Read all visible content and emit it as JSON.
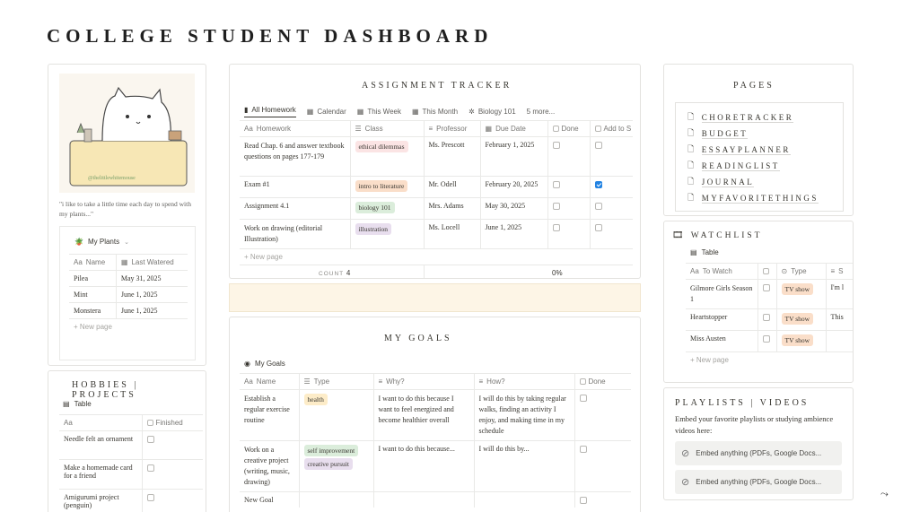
{
  "page_title": "COLLEGE STUDENT DASHBOARD",
  "quote": "\"i like to take a little time each day to spend with my plants...\"",
  "image_watermark": "@thelittlewhitemouse",
  "plants": {
    "db_title": "My Plants",
    "columns": [
      "Name",
      "Last Watered"
    ],
    "rows": [
      {
        "name": "Pilea",
        "date": "May 31, 2025"
      },
      {
        "name": "Mint",
        "date": "June 1, 2025"
      },
      {
        "name": "Monstera",
        "date": "June 1, 2025"
      }
    ],
    "new_page": "New page"
  },
  "hobbies": {
    "title": "HOBBIES | PROJECTS",
    "view": "Table",
    "columns": [
      "",
      "Finished"
    ],
    "rows": [
      {
        "name": "Needle felt an ornament"
      },
      {
        "name": "Make a homemade card for a friend"
      },
      {
        "name": "Amigurumi project (penguin)"
      }
    ]
  },
  "assignments": {
    "title": "ASSIGNMENT TRACKER",
    "tabs": [
      "All Homework",
      "Calendar",
      "This Week",
      "This Month",
      "Biology 101",
      "5 more..."
    ],
    "columns": [
      "Homework",
      "Class",
      "Professor",
      "Due Date",
      "Done",
      "Add to S"
    ],
    "rows": [
      {
        "hw": "Read Chap. 6 and answer textbook questions on pages 177-179",
        "cls": "ethical dilemmas",
        "prof": "Ms. Prescott",
        "due": "February 1, 2025",
        "done": false,
        "add": false
      },
      {
        "hw": "Exam #1",
        "cls": "intro to literature",
        "prof": "Mr. Odell",
        "due": "February 20, 2025",
        "done": false,
        "add": true
      },
      {
        "hw": "Assignment 4.1",
        "cls": "biology 101",
        "prof": "Mrs. Adams",
        "due": "May 30, 2025",
        "done": false,
        "add": false
      },
      {
        "hw": "Work on drawing (editorial Illustration)",
        "cls": "illustration",
        "prof": "Ms. Locell",
        "due": "June 1, 2025",
        "done": false,
        "add": false
      }
    ],
    "new_page": "New page",
    "count_label": "COUNT",
    "count": "4",
    "percent": "0%"
  },
  "goals": {
    "title": "MY GOALS",
    "db_title": "My Goals",
    "columns": [
      "Name",
      "Type",
      "Why?",
      "How?",
      "Done"
    ],
    "rows": [
      {
        "name": "Establish a regular exercise routine",
        "types": [
          "health"
        ],
        "why": "I want to do this because I want to feel energized and become healthier overall",
        "how": "I will do this by taking regular walks, finding an activity I enjoy, and making time in my schedule"
      },
      {
        "name": "Work on a creative project (writing, music, drawing)",
        "types": [
          "self improvement",
          "creative pursuit"
        ],
        "why": "I want to do this because...",
        "how": "I will do this by..."
      },
      {
        "name": "New Goal",
        "types": [],
        "why": "",
        "how": ""
      }
    ]
  },
  "pages": {
    "title": "PAGES",
    "links": [
      "CHORETRACKER",
      "BUDGET",
      "ESSAYPLANNER",
      "READINGLIST",
      "JOURNAL",
      "MYFAVORITETHINGS"
    ]
  },
  "watchlist": {
    "title": "WATCHLIST",
    "view": "Table",
    "columns": [
      "To Watch",
      "",
      "Type",
      "S"
    ],
    "rows": [
      {
        "name": "Gilmore Girls Season 1",
        "type": "TV show",
        "extra": "I'm l"
      },
      {
        "name": "Heartstopper",
        "type": "TV show",
        "extra": "This"
      },
      {
        "name": "Miss Austen",
        "type": "TV show",
        "extra": ""
      }
    ],
    "new_page": "New page"
  },
  "playlists": {
    "title": "PLAYLISTS | VIDEOS",
    "text": "Embed your favorite playlists or studying ambience videos here:",
    "embeds": [
      "Embed anything (PDFs, Google Docs...",
      "Embed anything (PDFs, Google Docs..."
    ]
  },
  "colors": {
    "tag_red": "#fbe4e4",
    "tag_orange": "#fadec9",
    "tag_green": "#dbeddb",
    "tag_purple": "#e8deee",
    "tag_yellow": "#fdecc8",
    "banner": "#fdf5e6",
    "checkbox_on": "#2383e2"
  }
}
